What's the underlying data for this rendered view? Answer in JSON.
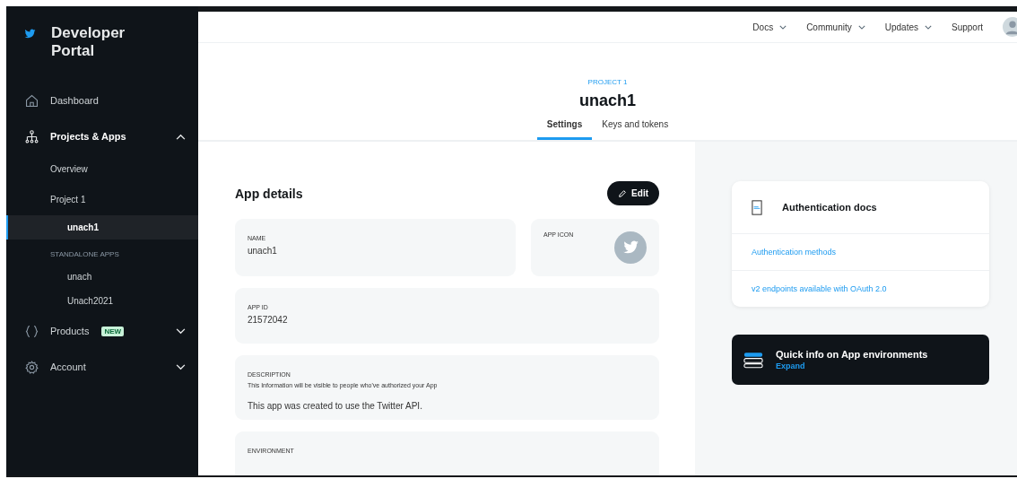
{
  "sidebar": {
    "brand": "Developer Portal",
    "items": [
      {
        "label": "Dashboard"
      },
      {
        "label": "Projects & Apps",
        "expanded": true,
        "children": [
          {
            "kind": "link",
            "label": "Overview",
            "selected": false
          },
          {
            "kind": "link",
            "label": "Project 1",
            "selected": false,
            "children": [
              {
                "label": "unach1",
                "selected": true
              }
            ]
          },
          {
            "kind": "section",
            "label": "STANDALONE APPS",
            "children": [
              {
                "label": "unach",
                "selected": false
              },
              {
                "label": "Unach2021",
                "selected": false
              }
            ]
          }
        ]
      },
      {
        "label": "Products",
        "badge": "NEW",
        "expanded": false
      },
      {
        "label": "Account",
        "expanded": false
      }
    ]
  },
  "top_nav": [
    {
      "label": "Docs",
      "dropdown": true
    },
    {
      "label": "Community",
      "dropdown": true
    },
    {
      "label": "Updates",
      "dropdown": true
    },
    {
      "label": "Support",
      "dropdown": false
    }
  ],
  "header": {
    "overline": "PROJECT 1",
    "title": "unach1",
    "tabs": [
      {
        "label": "Settings",
        "selected": true
      },
      {
        "label": "Keys and tokens",
        "selected": false
      }
    ]
  },
  "details": {
    "title": "App details",
    "edit_button": "Edit",
    "fields": [
      {
        "kind": "text",
        "label": "NAME",
        "value": "unach1"
      },
      {
        "kind": "icon",
        "label": "APP ICON"
      },
      {
        "kind": "text",
        "label": "APP ID",
        "value": "21572042"
      },
      {
        "kind": "text",
        "label": "DESCRIPTION",
        "hint": "This Information will be visible to people who've authorized your App",
        "value": "This app was created to use the Twitter API."
      },
      {
        "kind": "text",
        "label": "ENVIRONMENT"
      }
    ]
  },
  "auth_docs": {
    "title": "Authentication docs",
    "links": [
      "Authentication methods",
      "v2 endpoints available with OAuth 2.0"
    ]
  },
  "quick_info": {
    "title": "Quick info on App environments",
    "action": "Expand"
  }
}
